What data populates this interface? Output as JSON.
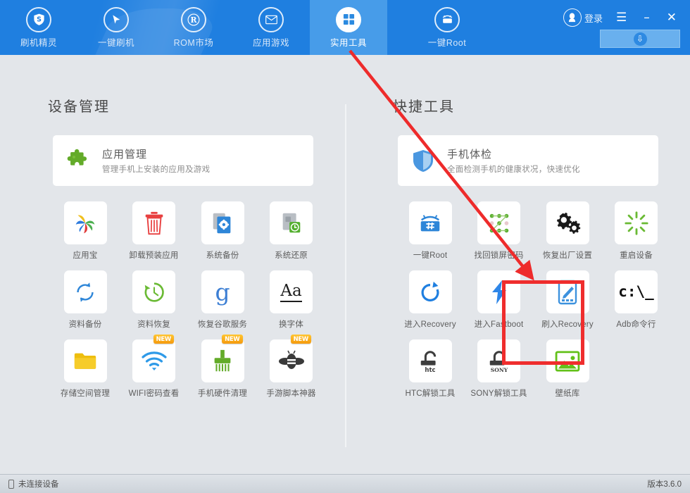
{
  "header": {
    "nav": [
      {
        "label": "刷机精灵",
        "icon": "shield-s-icon",
        "active": false
      },
      {
        "label": "一键刷机",
        "icon": "cursor-icon",
        "active": false
      },
      {
        "label": "ROM市场",
        "icon": "r-circle-icon",
        "active": false
      },
      {
        "label": "应用游戏",
        "icon": "envelope-icon",
        "active": false
      },
      {
        "label": "实用工具",
        "icon": "grid-squares-icon",
        "active": true
      },
      {
        "label": "一键Root",
        "icon": "android-robot-icon",
        "active": false
      }
    ],
    "login_label": "登录",
    "menu_icon": "hamburger-icon",
    "minimize_icon": "minimize-icon",
    "close_icon": "close-icon",
    "download_icon": "download-circle-icon"
  },
  "left": {
    "section_title": "设备管理",
    "feature": {
      "title": "应用管理",
      "subtitle": "管理手机上安装的应用及游戏",
      "icon": "puzzle-piece-icon"
    },
    "tiles": [
      {
        "label": "应用宝",
        "icon": "pinwheel-icon",
        "new": false
      },
      {
        "label": "卸载预装应用",
        "icon": "trash-can-icon",
        "new": false
      },
      {
        "label": "系统备份",
        "icon": "documents-gear-icon",
        "new": false
      },
      {
        "label": "系统还原",
        "icon": "document-clock-icon",
        "new": false
      },
      {
        "label": "资料备份",
        "icon": "sync-arrows-icon",
        "new": false
      },
      {
        "label": "资料恢复",
        "icon": "clock-restore-icon",
        "new": false
      },
      {
        "label": "恢复谷歌服务",
        "icon": "google-g-icon",
        "new": false
      },
      {
        "label": "换字体",
        "icon": "font-aa-icon",
        "new": false
      },
      {
        "label": "存储空间管理",
        "icon": "folder-icon",
        "new": false
      },
      {
        "label": "WIFI密码查看",
        "icon": "wifi-icon",
        "new": true
      },
      {
        "label": "手机硬件清理",
        "icon": "brush-icon",
        "new": true
      },
      {
        "label": "手游脚本神器",
        "icon": "bee-icon",
        "new": true
      }
    ]
  },
  "right": {
    "section_title": "快捷工具",
    "feature": {
      "title": "手机体检",
      "subtitle": "全面检测手机的健康状况，快速优化",
      "icon": "shield-icon"
    },
    "tiles": [
      {
        "label": "一键Root",
        "icon": "android-toolbox-icon",
        "new": false
      },
      {
        "label": "找回锁屏密码",
        "icon": "pattern-lock-icon",
        "new": false
      },
      {
        "label": "恢复出厂设置",
        "icon": "gears-icon",
        "new": false
      },
      {
        "label": "重启设备",
        "icon": "sunburst-restart-icon",
        "new": false
      },
      {
        "label": "进入Recovery",
        "icon": "refresh-arrow-icon",
        "new": false
      },
      {
        "label": "进入Fastboot",
        "icon": "lightning-bolt-icon",
        "new": false
      },
      {
        "label": "刷入Recovery",
        "icon": "tablet-pen-icon",
        "new": false,
        "highlighted": true
      },
      {
        "label": "Adb命令行",
        "icon": "command-prompt-icon",
        "new": false
      },
      {
        "label": "HTC解锁工具",
        "icon": "padlock-htc-icon",
        "new": false
      },
      {
        "label": "SONY解锁工具",
        "icon": "padlock-sony-icon",
        "new": false
      },
      {
        "label": "壁纸库",
        "icon": "picture-icon",
        "new": false
      }
    ],
    "tile_texts": {
      "adb_icon_text": "c:\\_",
      "htc_text": "htc",
      "sony_text": "SONY",
      "font_text": "Aa",
      "google_text": "g"
    }
  },
  "annotation": {
    "arrow_color": "#ee2b2b",
    "highlight_color": "#ef2d2d"
  },
  "footer": {
    "status": "未连接设备",
    "version": "版本3.6.0",
    "status_icon": "phone-icon"
  },
  "colors": {
    "header_blue": "#1f7fe0",
    "active_tab_blue": "#479ce9",
    "page_bg": "#e3e6ea"
  }
}
